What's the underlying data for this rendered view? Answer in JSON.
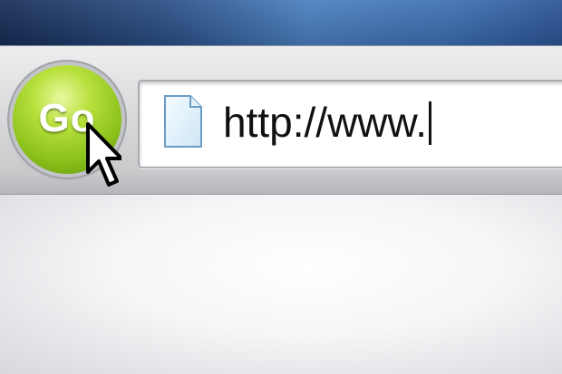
{
  "toolbar": {
    "go_button_label": "Go"
  },
  "address_bar": {
    "value": "http://www.",
    "page_icon": "document-icon"
  },
  "pointer": {
    "icon": "arrow-cursor-icon"
  },
  "colors": {
    "title_bar": "#2a4f86",
    "go_button": "#8bc21a",
    "toolbar": "#dcdcde",
    "address_bar_bg": "#ffffff"
  }
}
